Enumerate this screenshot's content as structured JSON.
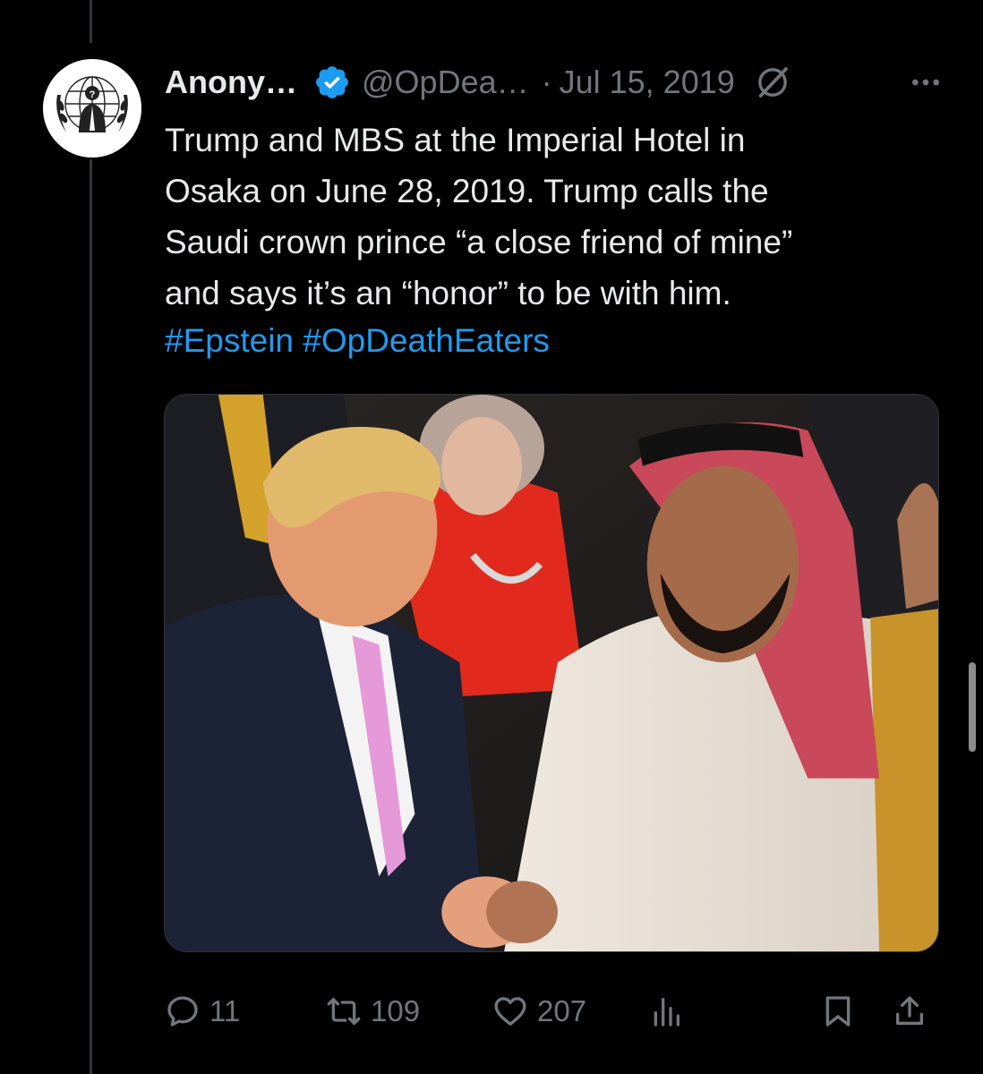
{
  "tweet": {
    "author_name": "Anony…",
    "handle": "@OpDea…",
    "separator": "·",
    "date": "Jul 15, 2019",
    "text": "Trump and MBS at the Imperial Hotel in\nOsaka on June 28, 2019. Trump calls the\nSaudi crown prince “a close friend of mine”\nand says it’s an “honor” to be with him.",
    "hashtags": [
      "#Epstein",
      "#OpDeathEaters"
    ]
  },
  "actions": {
    "replies": "11",
    "reposts": "109",
    "likes": "207"
  },
  "icons": {
    "avatar": "anonymous-logo",
    "verified": "verified-badge-icon",
    "grok": "grok-icon",
    "more": "more-icon",
    "reply": "reply-icon",
    "repost": "repost-icon",
    "like": "heart-icon",
    "views": "views-icon",
    "bookmark": "bookmark-icon",
    "share": "share-icon"
  },
  "colors": {
    "background": "#000000",
    "text": "#e7e9ea",
    "muted": "#71767b",
    "accent": "#1d9bf0"
  }
}
